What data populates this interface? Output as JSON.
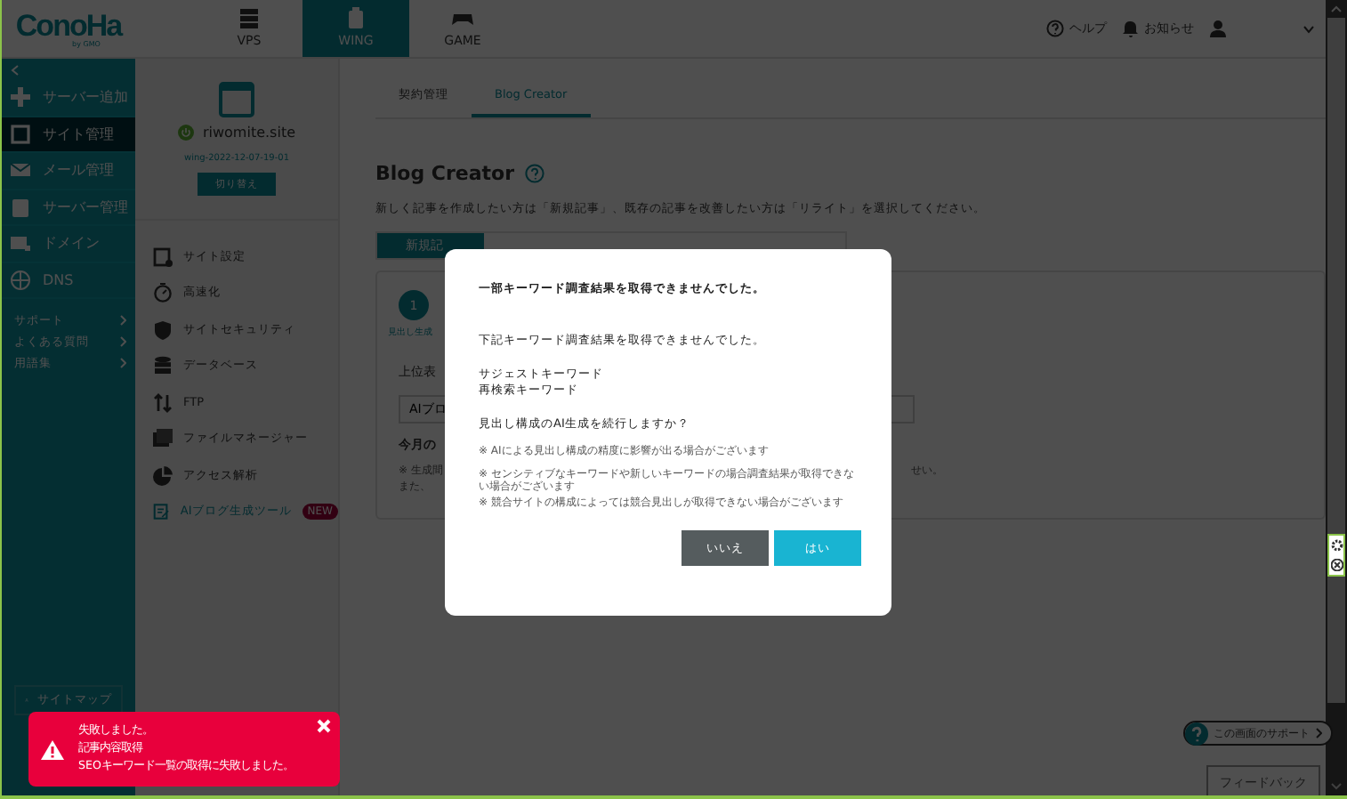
{
  "header": {
    "logo": "ConoHa",
    "logo_sub": "by GMO",
    "tabs": [
      {
        "label": "VPS",
        "selected": false
      },
      {
        "label": "WING",
        "selected": true
      },
      {
        "label": "GAME",
        "selected": false
      }
    ],
    "help": "ヘルプ",
    "notice": "お知らせ"
  },
  "sidebar": {
    "items": [
      {
        "label": "サーバー追加",
        "selected": false
      },
      {
        "label": "サイト管理",
        "selected": true
      },
      {
        "label": "メール管理",
        "selected": false
      },
      {
        "label": "サーバー管理",
        "selected": false
      },
      {
        "label": "ドメイン",
        "selected": false
      },
      {
        "label": "DNS",
        "selected": false
      }
    ],
    "links": [
      "サポート",
      "よくある質問",
      "用語集"
    ],
    "sitemap": "サイトマップ"
  },
  "site": {
    "name": "riwomite.site",
    "id": "wing-2022-12-07-19-01",
    "switch_button": "切り替え",
    "menu": [
      {
        "label": "サイト設定",
        "selected": false
      },
      {
        "label": "高速化",
        "selected": false
      },
      {
        "label": "サイトセキュリティ",
        "selected": false
      },
      {
        "label": "データベース",
        "selected": false
      },
      {
        "label": "FTP",
        "selected": false
      },
      {
        "label": "ファイルマネージャー",
        "selected": false
      },
      {
        "label": "アクセス解析",
        "selected": false
      },
      {
        "label": "AIブログ生成ツール",
        "selected": true,
        "badge": "NEW"
      }
    ]
  },
  "main": {
    "tabs": [
      {
        "label": "契約管理",
        "selected": false
      },
      {
        "label": "Blog Creator",
        "selected": true
      }
    ],
    "title": "Blog Creator",
    "description": "新しく記事を作成したい方は「新規記事」、既存の記事を改善したい方は「リライト」を選択してください。",
    "mode_tab": "新規記",
    "step_number": "1",
    "step_label": "見出し生成",
    "field_label": "上位表",
    "input_value": "AIブロ",
    "quota_label": "今月の",
    "notes": [
      "※ 生成間",
      "また、"
    ],
    "note_tail": "せい。"
  },
  "dialog": {
    "title": "一部キーワード調査結果を取得できませんでした。",
    "message": "下記キーワード調査結果を取得できませんでした。",
    "keywords": [
      "サジェストキーワード",
      "再検索キーワード"
    ],
    "question": "見出し構成のAI生成を続行しますか？",
    "notes": [
      "※ AIによる見出し構成の精度に影響が出る場合がございます",
      "※ センシティブなキーワードや新しいキーワードの場合調査結果が取得できない場合がございます",
      "※ 競合サイトの構成によっては競合見出しが取得できない場合がございます"
    ],
    "cancel_button": "いいえ",
    "ok_button": "はい"
  },
  "toast": {
    "lines": [
      "失敗しました。",
      "記事内容取得",
      "SEOキーワード一覧の取得に失敗しました。"
    ]
  },
  "support": {
    "label": "この画面のサポート",
    "feedback": "フィードバック"
  }
}
